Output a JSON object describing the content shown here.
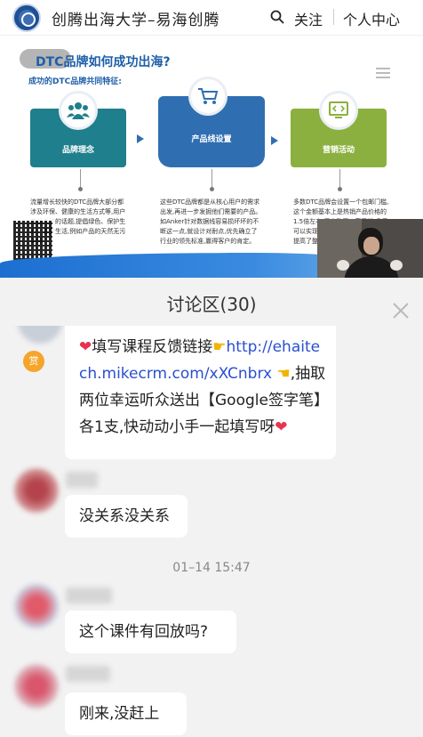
{
  "header": {
    "title": "创腾出海大学–易海创腾",
    "follow_label": "关注",
    "me_label": "个人中心"
  },
  "slide": {
    "title": "DTC品牌如何成功出海?",
    "subtitle": "成功的DTC品牌共同特征:",
    "cards": [
      {
        "label": "品牌理念",
        "icon": "people-icon",
        "color": "#1f7f8c"
      },
      {
        "label": "产品线设置",
        "icon": "cart-icon",
        "color": "#2f6fb1"
      },
      {
        "label": "营销活动",
        "icon": "code-screen-icon",
        "color": "#8bb03f"
      }
    ],
    "columns": [
      "流量增长较快的DTC品牌大部分都涉及环保、健康的生活方式等,用户普遍关注的话题,提倡绿色、保护生命、健康生活,例如产品的天然无污染等。",
      "这些DTC品牌都是从核心用户的需求出发,再进一步发掘他们需要的产品。如Anker针对数据线容易损坏坏的不断这一点,就设计对耐点,优先确立了行业的领先标准,赢得客户的肯定。",
      "多数DTC品牌会设置一个包邮门槛,这个金额基本上是热销产品价格的1.5倍左右,用户购买二家灵说,几乎可以实现一次买组合店铺内的产品,提高了整个产品的销售额。"
    ]
  },
  "discussion": {
    "title": "讨论区(30)",
    "reward_badge": "赏",
    "messages": [
      {
        "part1": "填写课程反馈链接",
        "link": "http://ehaitech.mikecrm.com/xXCnbrx",
        "part2": ",抽取两位幸运听众送出【Google签字笔】各1支,快动动小手一起填写呀"
      },
      {
        "text": "没关系没关系"
      },
      {
        "text": "这个课件有回放吗?"
      },
      {
        "text": "刚来,没赶上"
      }
    ],
    "timestamp": "01–14 15:47"
  },
  "colors": {
    "accent_blue": "#1e5fa8",
    "link_blue": "#2a4fd0",
    "reward_orange": "#f4a52a"
  }
}
